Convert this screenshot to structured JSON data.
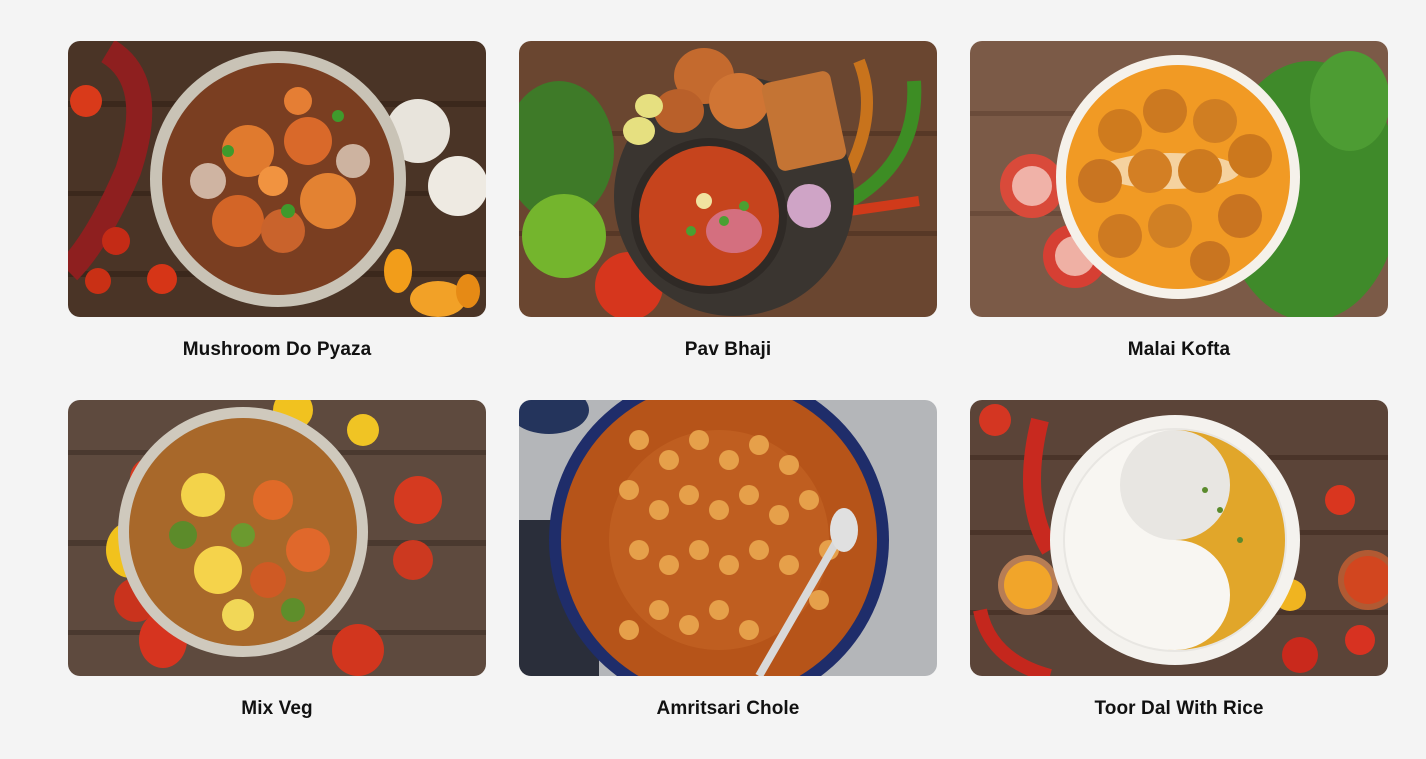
{
  "dishes": [
    {
      "name": "Mushroom Do Pyaza"
    },
    {
      "name": "Pav Bhaji"
    },
    {
      "name": "Malai Kofta"
    },
    {
      "name": "Mix Veg"
    },
    {
      "name": "Amritsari Chole"
    },
    {
      "name": "Toor Dal With Rice"
    }
  ]
}
